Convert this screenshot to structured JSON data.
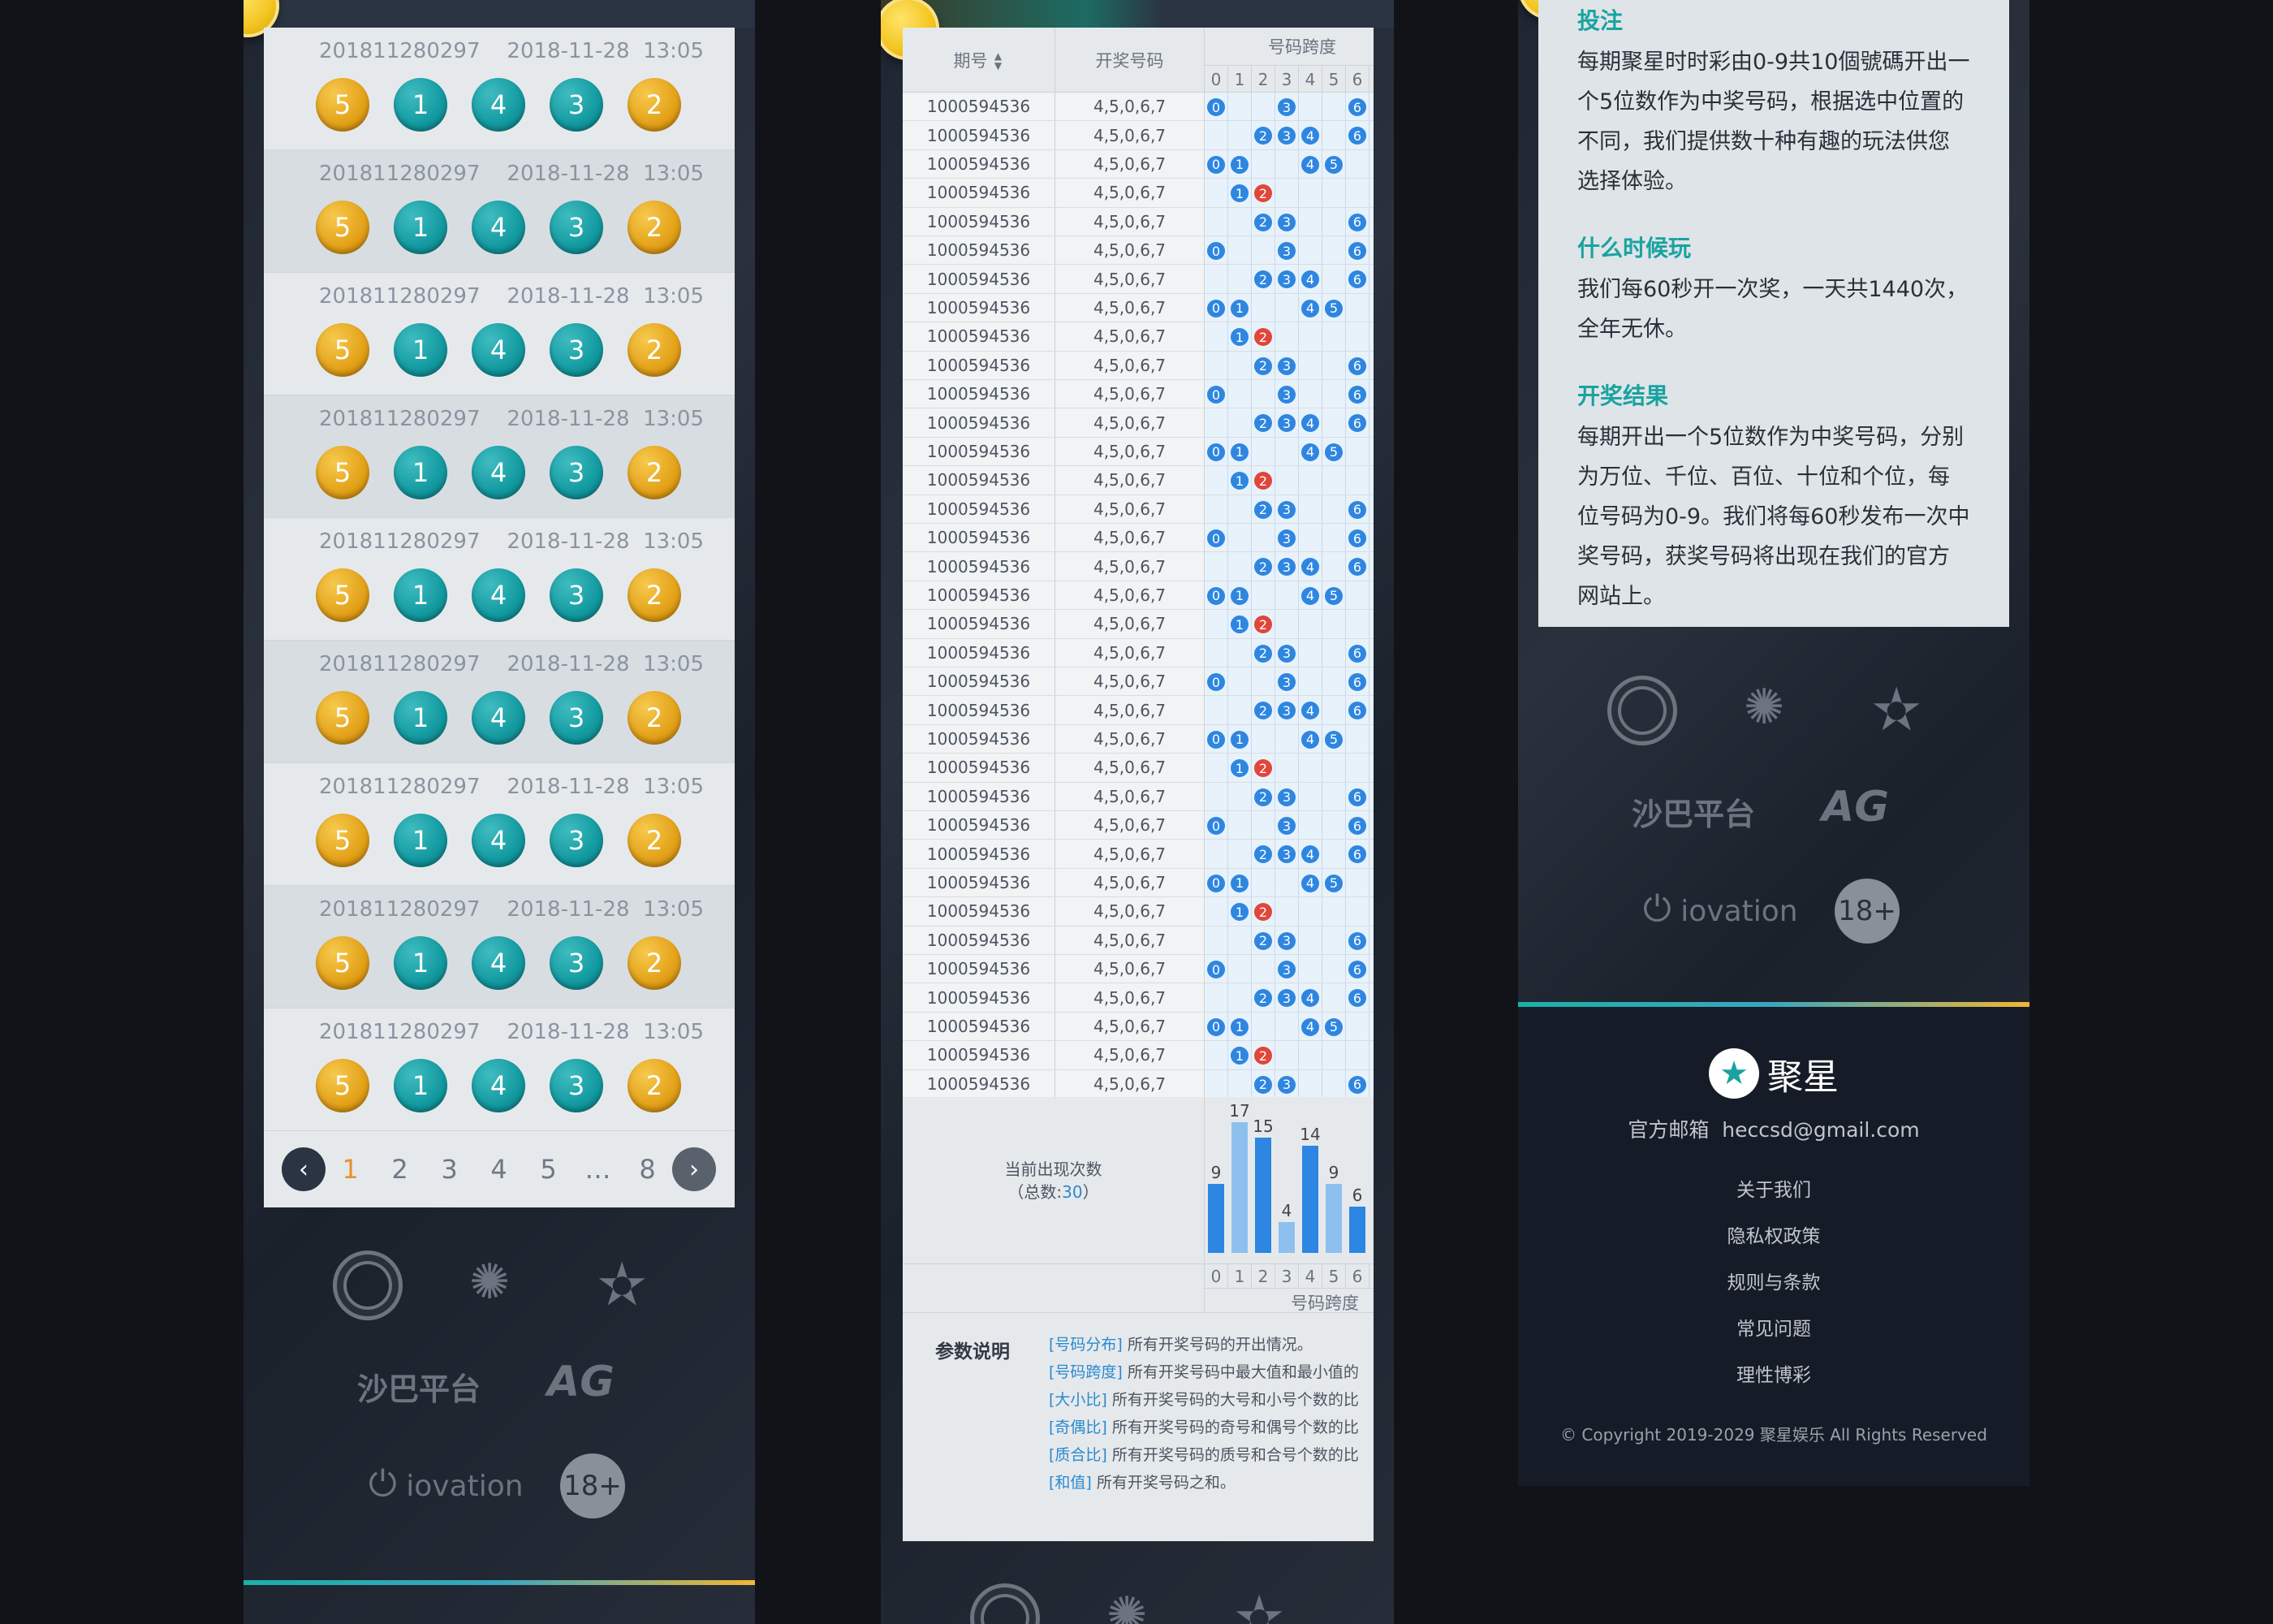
{
  "history": {
    "rows": [
      {
        "issue": "201811280297",
        "date": "2018-11-28",
        "time": "13:05",
        "numbers": [
          "5",
          "1",
          "4",
          "3",
          "2"
        ]
      },
      {
        "issue": "201811280297",
        "date": "2018-11-28",
        "time": "13:05",
        "numbers": [
          "5",
          "1",
          "4",
          "3",
          "2"
        ]
      },
      {
        "issue": "201811280297",
        "date": "2018-11-28",
        "time": "13:05",
        "numbers": [
          "5",
          "1",
          "4",
          "3",
          "2"
        ]
      },
      {
        "issue": "201811280297",
        "date": "2018-11-28",
        "time": "13:05",
        "numbers": [
          "5",
          "1",
          "4",
          "3",
          "2"
        ]
      },
      {
        "issue": "201811280297",
        "date": "2018-11-28",
        "time": "13:05",
        "numbers": [
          "5",
          "1",
          "4",
          "3",
          "2"
        ]
      },
      {
        "issue": "201811280297",
        "date": "2018-11-28",
        "time": "13:05",
        "numbers": [
          "5",
          "1",
          "4",
          "3",
          "2"
        ]
      },
      {
        "issue": "201811280297",
        "date": "2018-11-28",
        "time": "13:05",
        "numbers": [
          "5",
          "1",
          "4",
          "3",
          "2"
        ]
      },
      {
        "issue": "201811280297",
        "date": "2018-11-28",
        "time": "13:05",
        "numbers": [
          "5",
          "1",
          "4",
          "3",
          "2"
        ]
      },
      {
        "issue": "201811280297",
        "date": "2018-11-28",
        "time": "13:05",
        "numbers": [
          "5",
          "1",
          "4",
          "3",
          "2"
        ]
      }
    ],
    "pagination": {
      "prev": "‹",
      "pages": [
        "1",
        "2",
        "3",
        "4",
        "5",
        "…",
        "8"
      ],
      "current": "1",
      "next": "›"
    }
  },
  "logos": {
    "sabah": "沙巴平台",
    "ag": "AG",
    "iovation": "iovation",
    "age": "18+"
  },
  "trend": {
    "header_group": "号码跨度",
    "col_issue": "期号",
    "col_issue_sort": "▲▼",
    "col_numbers": "开奖号码",
    "digits": [
      "0",
      "1",
      "2",
      "3",
      "4",
      "5",
      "6"
    ],
    "rows": [
      {
        "issue": "1000594536",
        "numbers": "4,5,0,6,7",
        "dots": [
          0,
          3,
          6
        ]
      },
      {
        "issue": "1000594536",
        "numbers": "4,5,0,6,7",
        "dots": [
          2,
          3,
          4,
          6
        ]
      },
      {
        "issue": "1000594536",
        "numbers": "4,5,0,6,7",
        "dots": [
          0,
          1,
          4,
          5
        ]
      },
      {
        "issue": "1000594536",
        "numbers": "4,5,0,6,7",
        "dots": [
          1,
          2
        ]
      },
      {
        "issue": "1000594536",
        "numbers": "4,5,0,6,7",
        "dots": [
          2,
          3,
          6
        ]
      },
      {
        "issue": "1000594536",
        "numbers": "4,5,0,6,7",
        "dots": [
          0,
          3,
          6
        ]
      },
      {
        "issue": "1000594536",
        "numbers": "4,5,0,6,7",
        "dots": [
          2,
          3,
          4,
          6
        ]
      },
      {
        "issue": "1000594536",
        "numbers": "4,5,0,6,7",
        "dots": [
          0,
          1,
          4,
          5
        ]
      },
      {
        "issue": "1000594536",
        "numbers": "4,5,0,6,7",
        "dots": [
          1,
          2
        ]
      },
      {
        "issue": "1000594536",
        "numbers": "4,5,0,6,7",
        "dots": [
          2,
          3,
          6
        ]
      },
      {
        "issue": "1000594536",
        "numbers": "4,5,0,6,7",
        "dots": [
          0,
          3,
          6
        ]
      },
      {
        "issue": "1000594536",
        "numbers": "4,5,0,6,7",
        "dots": [
          2,
          3,
          4,
          6
        ]
      },
      {
        "issue": "1000594536",
        "numbers": "4,5,0,6,7",
        "dots": [
          0,
          1,
          4,
          5
        ]
      },
      {
        "issue": "1000594536",
        "numbers": "4,5,0,6,7",
        "dots": [
          1,
          2
        ]
      },
      {
        "issue": "1000594536",
        "numbers": "4,5,0,6,7",
        "dots": [
          2,
          3,
          6
        ]
      },
      {
        "issue": "1000594536",
        "numbers": "4,5,0,6,7",
        "dots": [
          0,
          3,
          6
        ]
      },
      {
        "issue": "1000594536",
        "numbers": "4,5,0,6,7",
        "dots": [
          2,
          3,
          4,
          6
        ]
      },
      {
        "issue": "1000594536",
        "numbers": "4,5,0,6,7",
        "dots": [
          0,
          1,
          4,
          5
        ]
      },
      {
        "issue": "1000594536",
        "numbers": "4,5,0,6,7",
        "dots": [
          1,
          2
        ]
      },
      {
        "issue": "1000594536",
        "numbers": "4,5,0,6,7",
        "dots": [
          2,
          3,
          6
        ]
      },
      {
        "issue": "1000594536",
        "numbers": "4,5,0,6,7",
        "dots": [
          0,
          3,
          6
        ]
      },
      {
        "issue": "1000594536",
        "numbers": "4,5,0,6,7",
        "dots": [
          2,
          3,
          4,
          6
        ]
      },
      {
        "issue": "1000594536",
        "numbers": "4,5,0,6,7",
        "dots": [
          0,
          1,
          4,
          5
        ]
      },
      {
        "issue": "1000594536",
        "numbers": "4,5,0,6,7",
        "dots": [
          1,
          2
        ]
      },
      {
        "issue": "1000594536",
        "numbers": "4,5,0,6,7",
        "dots": [
          2,
          3,
          6
        ]
      },
      {
        "issue": "1000594536",
        "numbers": "4,5,0,6,7",
        "dots": [
          0,
          3,
          6
        ]
      },
      {
        "issue": "1000594536",
        "numbers": "4,5,0,6,7",
        "dots": [
          2,
          3,
          4,
          6
        ]
      },
      {
        "issue": "1000594536",
        "numbers": "4,5,0,6,7",
        "dots": [
          0,
          1,
          4,
          5
        ]
      },
      {
        "issue": "1000594536",
        "numbers": "4,5,0,6,7",
        "dots": [
          1,
          2
        ]
      },
      {
        "issue": "1000594536",
        "numbers": "4,5,0,6,7",
        "dots": [
          2,
          3,
          6
        ]
      },
      {
        "issue": "1000594536",
        "numbers": "4,5,0,6,7",
        "dots": [
          0,
          3,
          6
        ]
      },
      {
        "issue": "1000594536",
        "numbers": "4,5,0,6,7",
        "dots": [
          2,
          3,
          4,
          6
        ]
      },
      {
        "issue": "1000594536",
        "numbers": "4,5,0,6,7",
        "dots": [
          0,
          1,
          4,
          5
        ]
      },
      {
        "issue": "1000594536",
        "numbers": "4,5,0,6,7",
        "dots": [
          1,
          2
        ]
      },
      {
        "issue": "1000594536",
        "numbers": "4,5,0,6,7",
        "dots": [
          2,
          3,
          6
        ]
      }
    ],
    "count_label": "当前出现次数",
    "total_prefix": "（总数:",
    "total": "30",
    "total_suffix": "）",
    "footer_label": "号码跨度",
    "params_title": "参数说明",
    "params": [
      {
        "key": "[号码分布]",
        "text": " 所有开奖号码的开出情况。"
      },
      {
        "key": "[号码跨度]",
        "text": " 所有开奖号码中最大值和最小值的"
      },
      {
        "key": "[大小比]",
        "text": " 所有开奖号码的大号和小号个数的比"
      },
      {
        "key": "[奇偶比]",
        "text": " 所有开奖号码的奇号和偶号个数的比"
      },
      {
        "key": "[质合比]",
        "text": " 所有开奖号码的质号和合号个数的比"
      },
      {
        "key": "[和值]",
        "text": " 所有开奖号码之和。"
      }
    ]
  },
  "chart_data": {
    "type": "bar",
    "categories": [
      "0",
      "1",
      "2",
      "3",
      "4",
      "5",
      "6"
    ],
    "values": [
      9,
      17,
      15,
      4,
      14,
      9,
      6
    ],
    "xlabel": "号码跨度",
    "ylabel": "",
    "title": ""
  },
  "about": {
    "sections": [
      {
        "title": "投注",
        "text": "每期聚星时时彩由0-9共10個號碼开出一个5位数作为中奖号码，根据选中位置的不同，我们提供数十种有趣的玩法供您选择体验。"
      },
      {
        "title": "什么时候玩",
        "text": "我们每60秒开一次奖，一天共1440次，全年无休。"
      },
      {
        "title": "开奖结果",
        "text": "每期开出一个5位数作为中奖号码，分别为万位、千位、百位、十位和个位，每位号码为0-9。我们将每60秒发布一次中奖号码，获奖号码将出现在我们的官方网站上。"
      }
    ]
  },
  "footer": {
    "brand": "聚星",
    "email_label": "官方邮箱",
    "email": "heccsd@gmail.com",
    "links": [
      "关于我们",
      "隐私权政策",
      "规则与条款",
      "常见问题",
      "理性博彩"
    ],
    "copyright": "© Copyright 2019-2029 聚星娱乐 All Rights Reserved"
  },
  "colors": {
    "gold": "#e3a118",
    "teal": "#129aa0",
    "accent": "#19a3a0",
    "dot_blue": "#2e86e0",
    "dot_red": "#e0463a",
    "page_active": "#e8912c"
  }
}
